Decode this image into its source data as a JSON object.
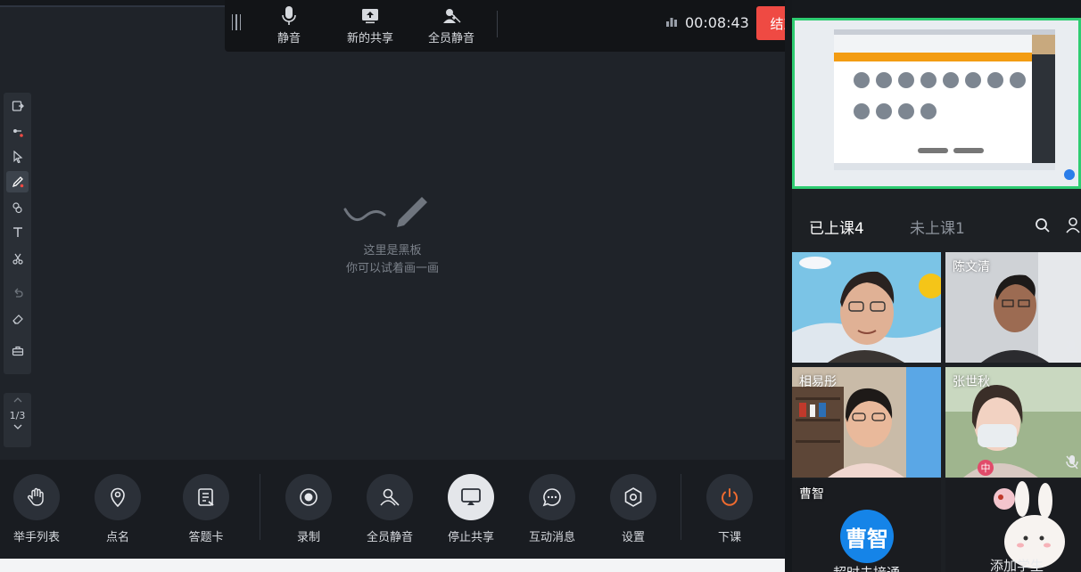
{
  "share_toolbar": {
    "buttons": [
      {
        "label": "静音",
        "icon": "microphone-icon"
      },
      {
        "label": "新的共享",
        "icon": "screen-share-icon"
      },
      {
        "label": "全员静音",
        "icon": "mute-all-icon"
      }
    ],
    "timer": "00:08:43",
    "stop_share_label": "结束共享"
  },
  "board": {
    "hint_line1": "这里是黑板",
    "hint_line2": "你可以试着画一画"
  },
  "pager": {
    "page": "1/3"
  },
  "bottom_bar": {
    "buttons": [
      {
        "label": "举手列表",
        "icon": "raise-hand-icon"
      },
      {
        "label": "点名",
        "icon": "roll-call-icon"
      },
      {
        "label": "答题卡",
        "icon": "answer-card-icon"
      },
      {
        "label": "录制",
        "icon": "record-icon"
      },
      {
        "label": "全员静音",
        "icon": "mute-all-icon"
      },
      {
        "label": "停止共享",
        "icon": "stop-share-icon"
      },
      {
        "label": "互动消息",
        "icon": "chat-icon"
      },
      {
        "label": "设置",
        "icon": "gear-icon"
      },
      {
        "label": "下课",
        "icon": "power-icon"
      }
    ]
  },
  "right_panel": {
    "tabs": [
      {
        "label": "已上课4",
        "active": true
      },
      {
        "label": "未上课1",
        "active": false
      }
    ],
    "participants": [
      {
        "name": ""
      },
      {
        "name": "陈文清"
      },
      {
        "name": "相易彤"
      },
      {
        "name": "张世秋"
      },
      {
        "name": "曹智",
        "avatar_text": "曹智",
        "caption": "超时未接通"
      },
      {
        "name": "",
        "caption": "添加学生"
      }
    ],
    "accent_color": "#2ecc71"
  },
  "colors": {
    "stop_share": "#ef4a43",
    "leave_class": "#ef6b2f",
    "avatar": "#1584e8"
  }
}
